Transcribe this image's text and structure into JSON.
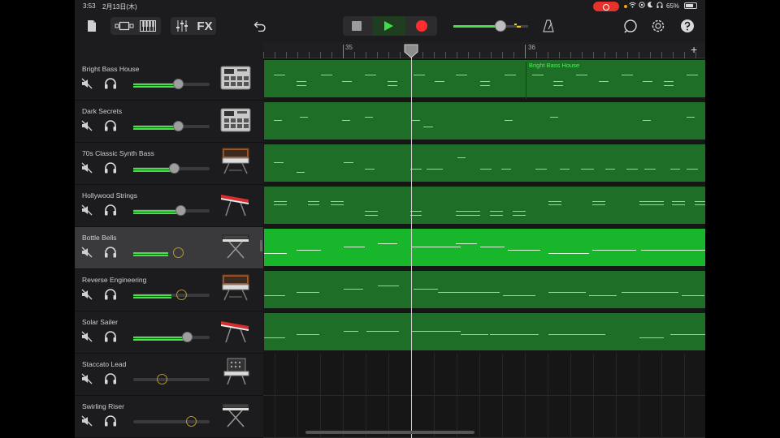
{
  "status_bar": {
    "time": "3:53",
    "date": "2月13日(木)",
    "battery": "65%"
  },
  "timeline": {
    "bar_35": "35",
    "bar_36": "36",
    "add_section": "+"
  },
  "tracks": [
    {
      "name": "Bright Bass House",
      "volume": 0.59,
      "knob": "grey",
      "instrument": "drum-machine"
    },
    {
      "name": "Dark Secrets",
      "volume": 0.58,
      "knob": "grey",
      "instrument": "drum-machine"
    },
    {
      "name": "70s Classic Synth Bass",
      "volume": 0.53,
      "knob": "grey",
      "instrument": "analog-synth"
    },
    {
      "name": "Hollywood Strings",
      "volume": 0.62,
      "knob": "grey",
      "instrument": "red-keyboard"
    },
    {
      "name": "Bottle Bells",
      "volume": 0.58,
      "knob": "hollow",
      "instrument": "keyboard-stand"
    },
    {
      "name": "Reverse Engineering",
      "volume": 0.63,
      "knob": "hollow",
      "instrument": "analog-synth"
    },
    {
      "name": "Solar Sailer",
      "volume": 0.7,
      "knob": "grey",
      "instrument": "red-keyboard"
    },
    {
      "name": "Staccato Lead",
      "volume": 0.37,
      "knob": "hollow",
      "instrument": "modular-synth"
    },
    {
      "name": "Swirling Riser",
      "volume": 0.75,
      "knob": "hollow",
      "instrument": "keyboard-stand"
    }
  ],
  "regions": {
    "bright_bass_house_label": "Bright Bass House"
  },
  "master_volume": 0.63,
  "colors": {
    "accent_green": "#47e04a",
    "region": "#1f6e28",
    "region_selected": "#17b62b",
    "record": "#ff2d2d"
  }
}
